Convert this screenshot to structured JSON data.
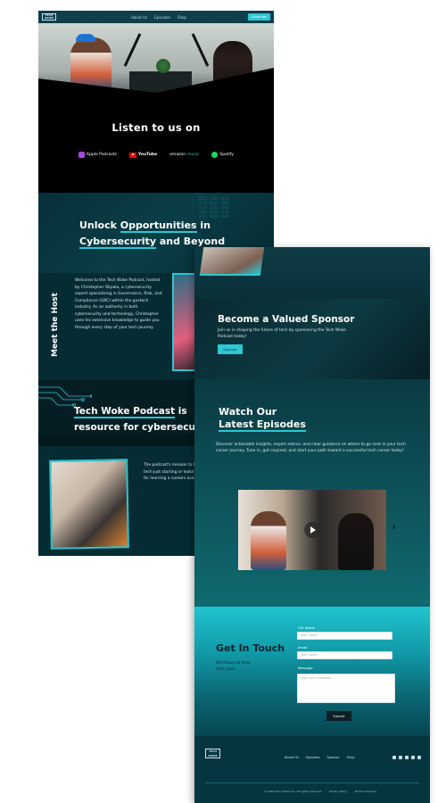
{
  "nav": {
    "logo_text": "TECH WOKE",
    "links": [
      "About Us",
      "Episodes",
      "Shop"
    ],
    "cta": "Subscribe"
  },
  "listen": {
    "title": "Listen to us on",
    "platforms": [
      {
        "name": "Apple Podcasts",
        "icon": "apple-podcasts-icon"
      },
      {
        "name": "YouTube",
        "icon": "youtube-icon"
      },
      {
        "name": "amazon",
        "suffix": "music",
        "icon": "amazon-music-icon"
      },
      {
        "name": "Spotify",
        "icon": "spotify-icon"
      }
    ]
  },
  "unlock": {
    "line1_pre": "Unlock ",
    "line1_highlight": "Opportunities",
    "line1_post": " in",
    "line2_highlight": "Cybersecurity",
    "line2_post": " and Beyond"
  },
  "meet": {
    "label": "Meet the Host",
    "text": "Welcome to the Tech Woke Podcast, hosted by Christopher Okpala, a cybersecurity expert specializing in Governance, Risk, and Compliance (GRC) within the govtech industry. As an authority in both cybersecurity and technology, Christopher uses his extensive knowledge to guide you through every step of your tech journey."
  },
  "resource": {
    "line1_highlight": "Tech Woke Podcast",
    "line1_post": " is",
    "line2": "resource for cybersecu"
  },
  "mission": {
    "text": "The podcast's mission to the wide range of c cybersecurity and tech just starting or looking role, Tech Woke Podcas resource for learning a careers available and first steps into the ind"
  },
  "sponsor": {
    "title": "Become a Valued Sponsor",
    "text": "Join us in shaping the future of tech by sponsoring the Tech Woke Podcast today!",
    "button": "Sponsor"
  },
  "episodes": {
    "title_line1": "Watch Our",
    "title_line2": "Latest Episodes",
    "text": "Discover actionable insights, expert advice, and clear guidance on where to go next in your tech career journey. Tune in, get inspired, and start your path toward a successful tech career today!",
    "next_icon": "chevron-right-icon"
  },
  "contact": {
    "title": "Get In Touch",
    "subtitle": "We'd love to hear from you!",
    "fields": [
      {
        "label": "Full Name",
        "placeholder": "Your name"
      },
      {
        "label": "Email",
        "placeholder": "Your email"
      }
    ],
    "message_label": "Message",
    "message_placeholder": "Type your message...",
    "submit": "Submit"
  },
  "footer": {
    "logo_text": "TECH WOKE",
    "links": [
      "About Us",
      "Episodes",
      "Sponsor",
      "Shop"
    ],
    "copyright": "© 2024 Tech Woke LLC. All rights reserved.",
    "privacy": "Privacy Policy",
    "terms": "Terms of Service"
  },
  "colors": {
    "accent": "#2ec6d2",
    "dark": "#03191e",
    "teal": "#0a3e47"
  }
}
